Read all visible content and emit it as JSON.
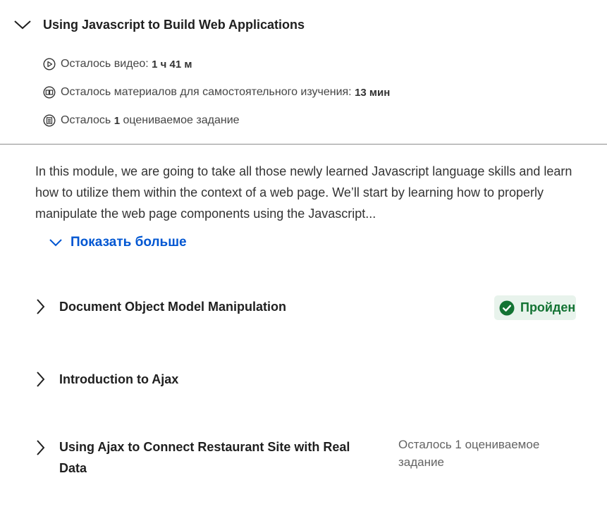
{
  "module": {
    "title": "Using Javascript to Build Web Applications",
    "meta": {
      "video_prefix": "Осталось видео: ",
      "video_value": "1 ч 41 м",
      "reading_prefix": "Осталось материалов для самостоятельного изучения: ",
      "reading_value": "13 мин",
      "assignment_prefix": "Осталось ",
      "assignment_count": "1",
      "assignment_suffix": " оцениваемое задание"
    },
    "description": "In this module, we are going to take all those newly learned Javascript language skills and learn how to utilize them within the context of a web page. We’ll start by learning how to properly manipulate the web page components using the Javascript...",
    "show_more_label": "Показать больше"
  },
  "lessons": [
    {
      "title": "Document Object Model Manipulation",
      "status_label": "Пройден"
    },
    {
      "title": "Introduction to Ajax"
    },
    {
      "title": "Using Ajax to Connect Restaurant Site with Real Data",
      "note": "Осталось 1 оцениваемое задание"
    }
  ],
  "colors": {
    "link": "#0056d2",
    "passed_text": "#137333",
    "passed_bg": "#e8f3ec",
    "divider": "#8c8c8c"
  }
}
